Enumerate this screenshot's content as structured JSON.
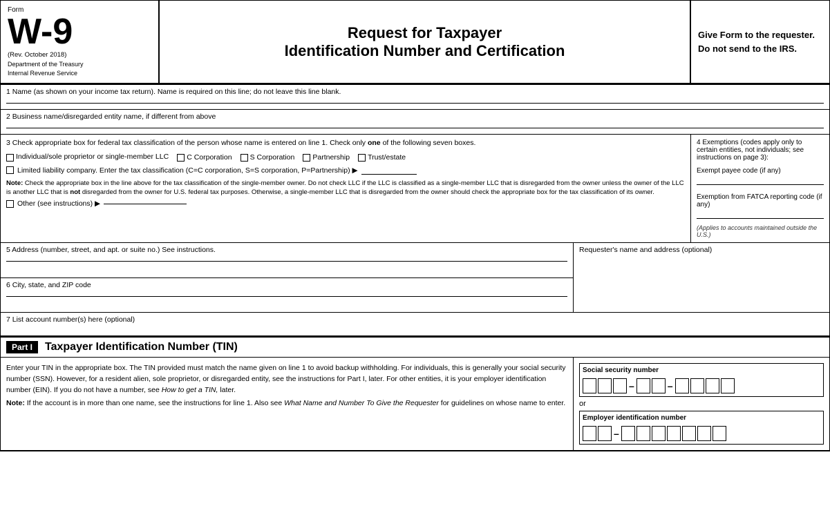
{
  "header": {
    "form_label": "Form",
    "form_number": "W-9",
    "rev": "(Rev. October 2018)",
    "dept1": "Department of the Treasury",
    "dept2": "Internal Revenue Service",
    "title_line1": "Request for Taxpayer",
    "title_line2": "Identification Number and Certification",
    "give_form": "Give Form to the requester. Do not send to the IRS."
  },
  "fields": {
    "line1_label": "1  Name (as shown on your income tax return). Name is required on this line; do not leave this line blank.",
    "line2_label": "2  Business name/disregarded entity name, if different from above",
    "line3_label": "3  Check appropriate box for federal tax classification of the person whose name is entered on line 1. Check only",
    "line3_bold": "one",
    "line3_label2": "of the following seven boxes.",
    "checkbox_individual": "Individual/sole proprietor or single-member LLC",
    "checkbox_c_corp": "C Corporation",
    "checkbox_s_corp": "S Corporation",
    "checkbox_partnership": "Partnership",
    "checkbox_trust": "Trust/estate",
    "llc_text": "Limited liability company. Enter the tax classification (C=C corporation, S=S corporation, P=Partnership) ▶",
    "note_label": "Note:",
    "note_text": " Check the appropriate box in the line above for the tax classification of the single-member owner.  Do not check LLC if the LLC is classified as a single-member LLC that is disregarded from the owner unless the owner of the LLC is another LLC that is ",
    "note_not": "not",
    "note_text2": " disregarded from the owner for U.S. federal tax purposes. Otherwise, a single-member LLC that is disregarded from the owner should check the appropriate box for the tax classification of its owner.",
    "other_text": "Other (see instructions) ▶",
    "line4_label": "4  Exemptions (codes apply only to certain entities, not individuals; see instructions on page 3):",
    "exempt_payee_label": "Exempt payee code (if any)",
    "fatca_label": "Exemption from FATCA reporting code (if any)",
    "fatca_note": "(Applies to accounts maintained outside the U.S.)",
    "line5_label": "5  Address (number, street, and apt. or suite no.) See instructions.",
    "requester_label": "Requester's name and address (optional)",
    "line6_label": "6  City, state, and ZIP code",
    "line7_label": "7  List account number(s) here (optional)"
  },
  "part_i": {
    "badge": "Part I",
    "title": "Taxpayer Identification Number (TIN)",
    "description": "Enter your TIN in the appropriate box. The TIN provided must match the name given on line 1 to avoid backup withholding. For individuals, this is generally your social security number (SSN). However, for a resident alien, sole proprietor, or disregarded entity, see the instructions for Part I, later. For other entities, it is your employer identification number (EIN). If you do not have a number, see ",
    "how_to_get": "How to get a TIN,",
    "description2": " later.",
    "note_label": "Note:",
    "note_text": " If the account is in more than one name, see the instructions for line 1. Also see ",
    "what_name": "What Name and Number To Give the Requester",
    "note_text2": " for guidelines on whose name to enter.",
    "ssn_label": "Social security number",
    "or_text": "or",
    "ein_label": "Employer identification number"
  }
}
